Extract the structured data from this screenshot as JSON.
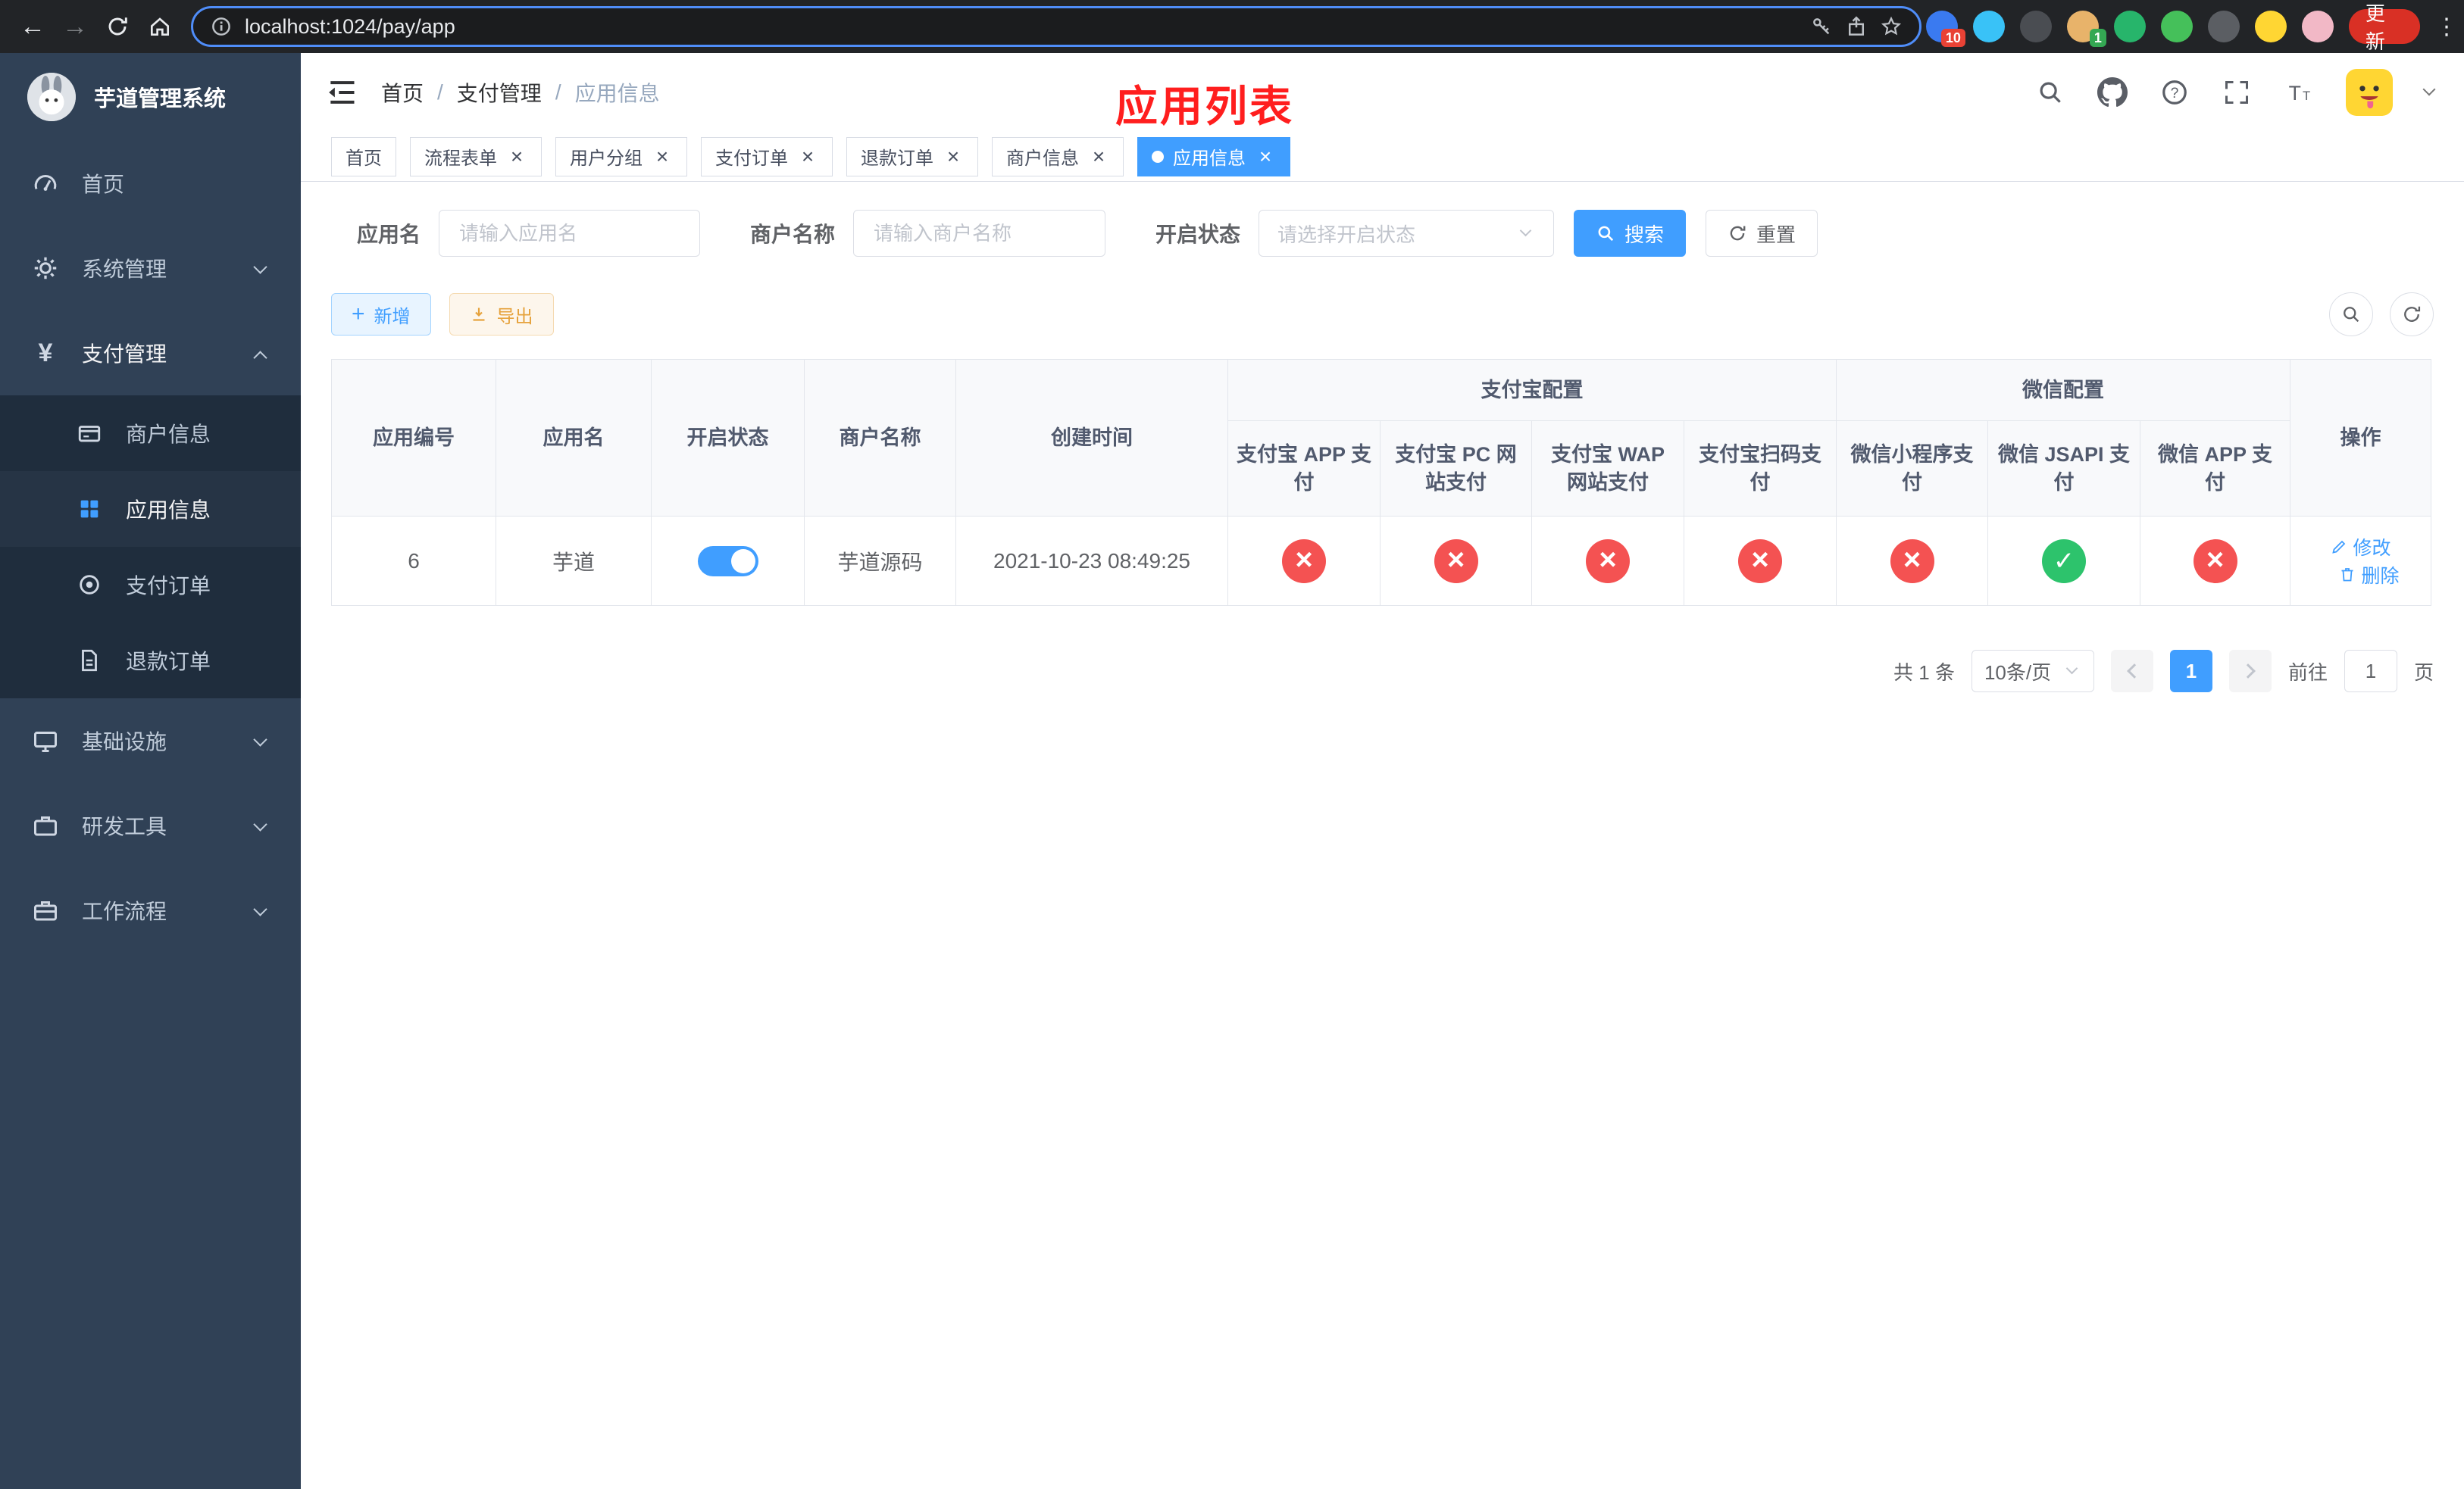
{
  "browser": {
    "url": "localhost:1024/pay/app",
    "update_button": "更新",
    "ext_badge_count": "10",
    "profile_badge_count": "1"
  },
  "sidebar": {
    "app_title": "芋道管理系统",
    "items": [
      {
        "label": "首页"
      },
      {
        "label": "系统管理"
      },
      {
        "label": "支付管理",
        "children": [
          {
            "label": "商户信息"
          },
          {
            "label": "应用信息"
          },
          {
            "label": "支付订单"
          },
          {
            "label": "退款订单"
          }
        ]
      },
      {
        "label": "基础设施"
      },
      {
        "label": "研发工具"
      },
      {
        "label": "工作流程"
      }
    ]
  },
  "header": {
    "breadcrumb": [
      "首页",
      "支付管理",
      "应用信息"
    ],
    "page_title": "应用列表"
  },
  "tabs": [
    {
      "label": "首页"
    },
    {
      "label": "流程表单"
    },
    {
      "label": "用户分组"
    },
    {
      "label": "支付订单"
    },
    {
      "label": "退款订单"
    },
    {
      "label": "商户信息"
    },
    {
      "label": "应用信息"
    }
  ],
  "filters": {
    "app_name_label": "应用名",
    "app_name_placeholder": "请输入应用名",
    "merchant_label": "商户名称",
    "merchant_placeholder": "请输入商户名称",
    "status_label": "开启状态",
    "status_placeholder": "请选择开启状态",
    "search_button": "搜索",
    "reset_button": "重置"
  },
  "toolbar": {
    "add_button": "新增",
    "export_button": "导出"
  },
  "table": {
    "groups": {
      "alipay": "支付宝配置",
      "wechat": "微信配置"
    },
    "columns": [
      "应用编号",
      "应用名",
      "开启状态",
      "商户名称",
      "创建时间",
      "支付宝 APP 支付",
      "支付宝 PC 网站支付",
      "支付宝 WAP 网站支付",
      "支付宝扫码支付",
      "微信小程序支付",
      "微信 JSAPI 支付",
      "微信 APP 支付",
      "操作"
    ],
    "rows": [
      {
        "app_id": "6",
        "app_name": "芋道",
        "enabled": true,
        "merchant_name": "芋道源码",
        "create_time": "2021-10-23 08:49:25",
        "alipay_app": false,
        "alipay_pc": false,
        "alipay_wap": false,
        "alipay_qr": false,
        "wechat_mini": false,
        "wechat_jsapi": true,
        "wechat_app": false,
        "actions": {
          "edit": "修改",
          "delete": "删除"
        }
      }
    ]
  },
  "pagination": {
    "total_text": "共 1 条",
    "page_size": "10条/页",
    "current_page": "1",
    "goto_label": "前往",
    "goto_value": "1",
    "goto_suffix": "页"
  },
  "colors": {
    "primary": "#409eff",
    "success": "#2dc36c",
    "danger": "#f45252",
    "title_red": "#ff1e1e",
    "sidebar_bg": "#304156",
    "submenu_bg": "#1f2d3d"
  }
}
